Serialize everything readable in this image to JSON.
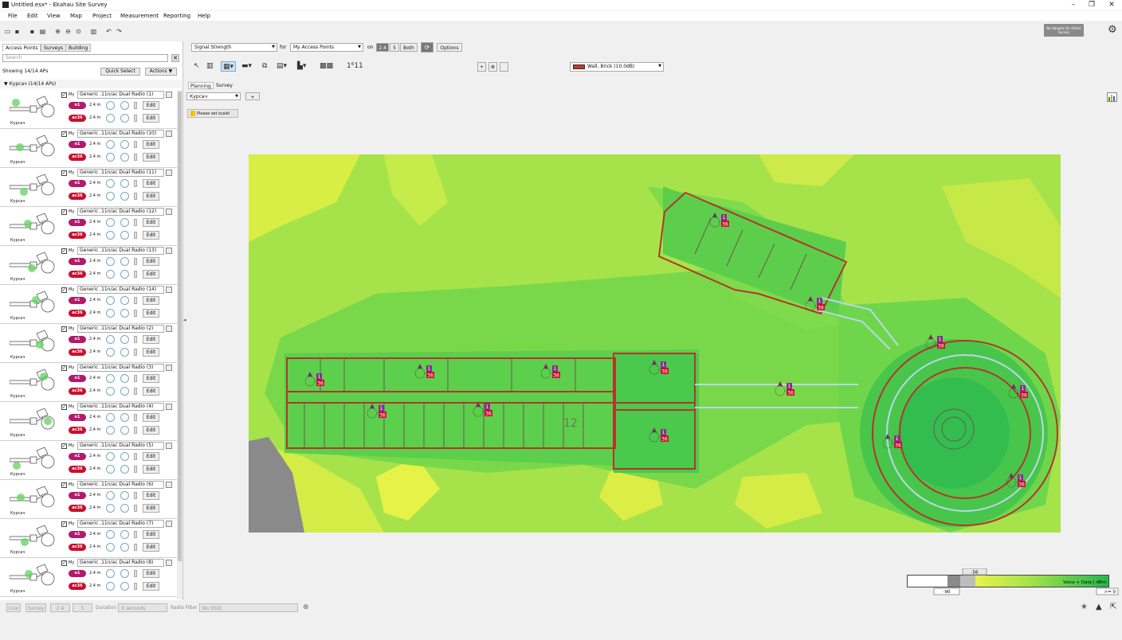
{
  "window": {
    "title": "Untitled.esx* - Ekahau Site Survey"
  },
  "menu": [
    "File",
    "Edit",
    "View",
    "Map",
    "Project",
    "Measurement",
    "Reporting",
    "Help"
  ],
  "adapter": {
    "label": "No Adapter for Active Survey"
  },
  "left_panel": {
    "tabs": [
      "Access Points",
      "Surveys",
      "Building"
    ],
    "search_placeholder": "Search",
    "showing": "Showing 14/14 APs",
    "quick_select": "Quick Select",
    "actions": "Actions ▼",
    "group": "Курсач (14/14 APs)",
    "ap_template": {
      "prefix": "My",
      "height": "2.4 m",
      "band_n": "n1",
      "band_ac": "ac36",
      "edit": "Edit",
      "floor": "Курсач"
    },
    "aps": [
      "Generic .11n/ac Dual Radio (1)",
      "Generic .11n/ac Dual Radio (10)",
      "Generic .11n/ac Dual Radio (11)",
      "Generic .11n/ac Dual Radio (12)",
      "Generic .11n/ac Dual Radio (13)",
      "Generic .11n/ac Dual Radio (14)",
      "Generic .11n/ac Dual Radio (2)",
      "Generic .11n/ac Dual Radio (3)",
      "Generic .11n/ac Dual Radio (4)",
      "Generic .11n/ac Dual Radio (5)",
      "Generic .11n/ac Dual Radio (6)",
      "Generic .11n/ac Dual Radio (7)",
      "Generic .11n/ac Dual Radio (8)"
    ]
  },
  "view_bar": {
    "visualization": "Signal Strength",
    "for_label": "for",
    "target": "My Access Points",
    "on_label": "on",
    "band_24": "2.4",
    "band_5": "5",
    "band_both": "Both",
    "options": "Options",
    "wall": "Wall, Brick (10.0dB)"
  },
  "plan_tabs": [
    "Planning",
    "Survey"
  ],
  "floor": "Курсач",
  "floor_add": "+",
  "scale_note": "Please set scale!",
  "map": {
    "ap_labels": {
      "n": "1",
      "ac": "36"
    },
    "room_label": "12"
  },
  "legend": {
    "marker_value": "-56",
    "low_value": "-90",
    "high_value": ">= 0",
    "label": "Voice + Data | dBm"
  },
  "statusbar": {
    "live": "Live",
    "survey": "Survey",
    "b24": "2.4",
    "b5": "5",
    "duration": "Duration",
    "duration_value": "3 seconds",
    "radio_filter": "Radio Filter",
    "ssid": "No SSID"
  }
}
